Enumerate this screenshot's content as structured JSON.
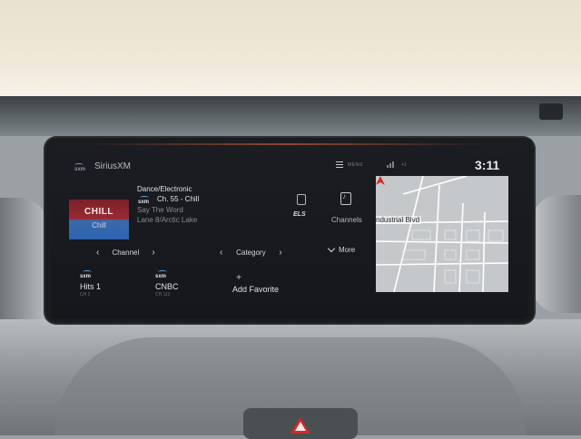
{
  "header": {
    "app_title": "SiriusXM",
    "app_logo": "sxm",
    "menu_label": "MENU",
    "status_text": "+1",
    "clock": "3:11"
  },
  "now_playing": {
    "art_text": "CHILL",
    "art_sub": "Chill",
    "genre": "Dance/Electronic",
    "sxm_label": "sxm",
    "channel": "Ch. 55 - Chill",
    "song": "Say The Word",
    "artist": "Lane 8/Arctic Lake",
    "els_label": "ELS",
    "channels_label": "Channels"
  },
  "controls": {
    "channel_label": "Channel",
    "category_label": "Category",
    "more_label": "More",
    "prev": "‹",
    "next": "›"
  },
  "presets": [
    {
      "logo": "sxm",
      "name": "Hits 1",
      "number": "CH 2"
    },
    {
      "logo": "sxm",
      "name": "CNBC",
      "number": "CH 112"
    }
  ],
  "add_favorite": {
    "icon": "+",
    "label": "Add Favorite"
  },
  "map": {
    "street": "ndustrial Blvd"
  },
  "icons": [
    "menu-icon",
    "signal-icon",
    "tune-icon",
    "channels-icon",
    "chevron-left-icon",
    "chevron-right-icon",
    "chevron-down-icon",
    "plus-icon",
    "vehicle-icon",
    "hazard-icon"
  ],
  "colors": {
    "screen_bg": "#15171b",
    "accent_blue": "#5ea5e0",
    "album_red": "#9a2a33",
    "album_blue": "#2d63b0",
    "vehicle_red": "#d22a2a"
  }
}
